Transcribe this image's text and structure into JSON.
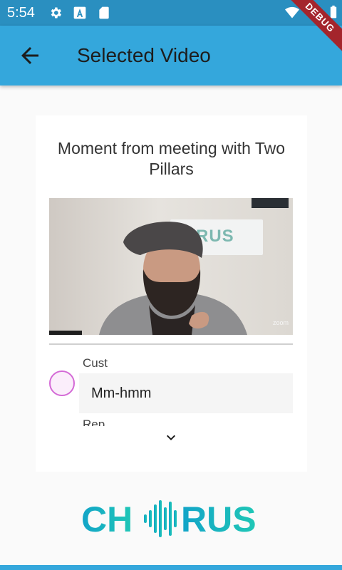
{
  "status_bar": {
    "time": "5:54",
    "icons": [
      "gear-icon",
      "a-icon",
      "sd-card-icon",
      "wifi-icon",
      "battery-icon"
    ]
  },
  "debug_banner": "DEBUG",
  "app_bar": {
    "title": "Selected Video",
    "back_icon": "arrow-back-icon",
    "background": "#34a7dc"
  },
  "card": {
    "title": "Moment from meeting with Two Pillars",
    "video": {
      "sign_text": "RUS",
      "watermark": "zoom"
    },
    "transcript": [
      {
        "speaker": "Cust",
        "text": "Mm-hmm",
        "avatar_color": "#d46ad6"
      },
      {
        "speaker": "Rep",
        "text": ""
      }
    ],
    "expand_icon": "chevron-down-icon"
  },
  "footer_logo": {
    "text_left": "CH",
    "text_right": "RUS",
    "color": "#1aa8c2"
  }
}
